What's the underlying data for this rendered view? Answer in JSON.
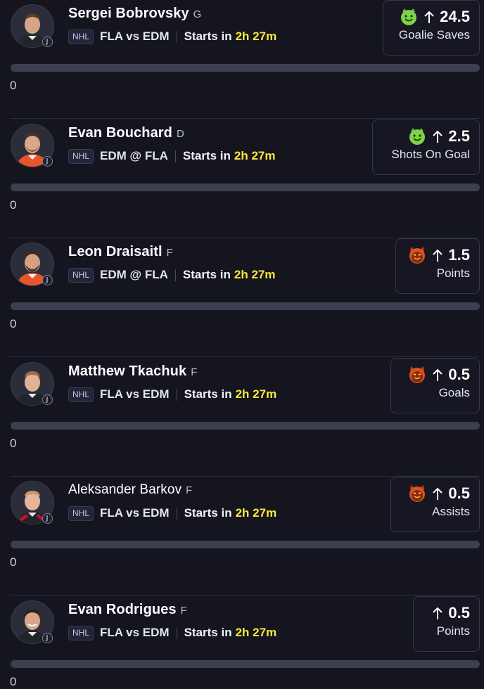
{
  "players": [
    {
      "name": "Sergei Bobrovsky",
      "position": "G",
      "league": "NHL",
      "matchup": "FLA vs EDM",
      "starts_label": "Starts in",
      "starts_time": "2h 27m",
      "prop_line": "24.5",
      "prop_stat": "Goalie Saves",
      "prop_icon": "green-smiley-emoji-icon",
      "progress_fraction": 0,
      "progress_value": "0"
    },
    {
      "name": "Evan Bouchard",
      "position": "D",
      "league": "NHL",
      "matchup": "EDM @ FLA",
      "starts_label": "Starts in",
      "starts_time": "2h 27m",
      "prop_line": "2.5",
      "prop_stat": "Shots On Goal",
      "prop_icon": "green-smiley-emoji-icon",
      "progress_fraction": 0,
      "progress_value": "0"
    },
    {
      "name": "Leon Draisaitl",
      "position": "F",
      "league": "NHL",
      "matchup": "EDM @ FLA",
      "starts_label": "Starts in",
      "starts_time": "2h 27m",
      "prop_line": "1.5",
      "prop_stat": "Points",
      "prop_icon": "devil-emoji-icon",
      "progress_fraction": 0,
      "progress_value": "0"
    },
    {
      "name": "Matthew Tkachuk",
      "position": "F",
      "league": "NHL",
      "matchup": "FLA vs EDM",
      "starts_label": "Starts in",
      "starts_time": "2h 27m",
      "prop_line": "0.5",
      "prop_stat": "Goals",
      "prop_icon": "devil-emoji-icon",
      "progress_fraction": 0,
      "progress_value": "0"
    },
    {
      "name": "Aleksander Barkov",
      "position": "F",
      "league": "NHL",
      "matchup": "FLA vs EDM",
      "starts_label": "Starts in",
      "starts_time": "2h 27m",
      "prop_line": "0.5",
      "prop_stat": "Assists",
      "prop_icon": "devil-emoji-icon",
      "progress_fraction": 0,
      "progress_value": "0"
    },
    {
      "name": "Evan Rodrigues",
      "position": "F",
      "league": "NHL",
      "matchup": "FLA vs EDM",
      "starts_label": "Starts in",
      "starts_time": "2h 27m",
      "prop_line": "0.5",
      "prop_stat": "Points",
      "prop_icon": "",
      "progress_fraction": 0,
      "progress_value": "0"
    }
  ],
  "colors": {
    "background": "#14151f",
    "countdown": "#ffe93a",
    "progress_track": "#3d3f4e",
    "card_border": "#363849"
  }
}
